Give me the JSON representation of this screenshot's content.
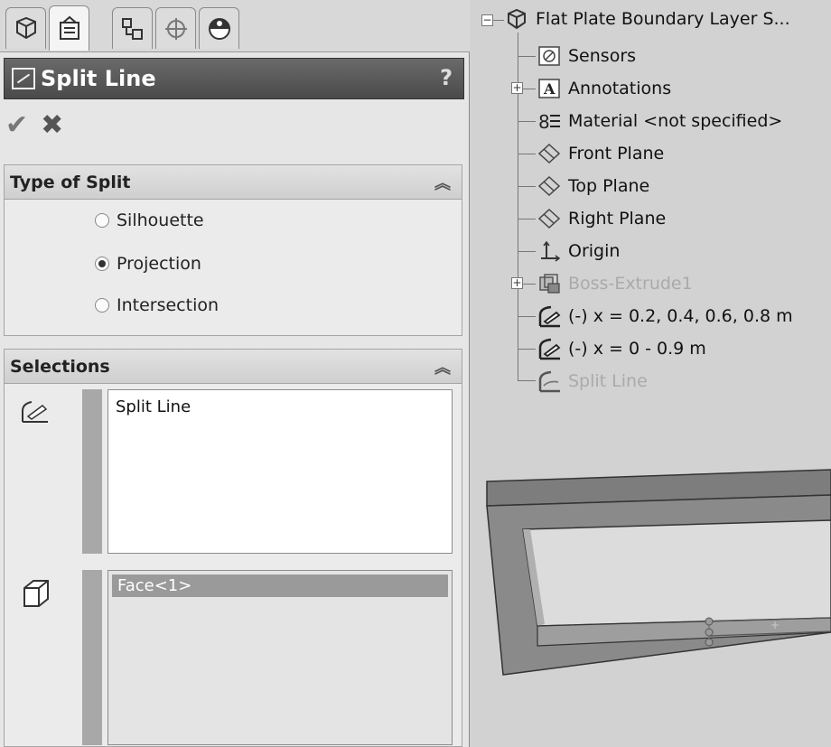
{
  "property_manager": {
    "tabs": [
      {
        "icon": "feature-manager-icon"
      },
      {
        "icon": "property-manager-icon"
      },
      {
        "icon": "configuration-manager-icon"
      },
      {
        "icon": "dim-xpert-icon"
      },
      {
        "icon": "display-manager-icon"
      }
    ],
    "title": "Split Line",
    "help": "?",
    "type_of_split": {
      "header": "Type of Split",
      "options": [
        "Silhouette",
        "Projection",
        "Intersection"
      ],
      "selected": "Projection"
    },
    "selections": {
      "header": "Selections",
      "sketch_list": [
        "Split Line"
      ],
      "face_list": [
        "Face<1>"
      ]
    }
  },
  "feature_tree": {
    "root": "Flat Plate Boundary Layer S...",
    "items": [
      {
        "label": "Sensors",
        "icon": "sensors-icon",
        "dimmed": false
      },
      {
        "label": "Annotations",
        "icon": "annotations-icon",
        "dimmed": false
      },
      {
        "label": "Material <not specified>",
        "icon": "material-icon",
        "dimmed": false
      },
      {
        "label": "Front Plane",
        "icon": "plane-icon",
        "dimmed": false
      },
      {
        "label": "Top Plane",
        "icon": "plane-icon",
        "dimmed": false
      },
      {
        "label": "Right Plane",
        "icon": "plane-icon",
        "dimmed": false
      },
      {
        "label": "Origin",
        "icon": "origin-icon",
        "dimmed": false
      },
      {
        "label": "Boss-Extrude1",
        "icon": "extrude-icon",
        "dimmed": true
      },
      {
        "label": "(-) x = 0.2, 0.4, 0.6, 0.8 m",
        "icon": "sketch-icon",
        "dimmed": false
      },
      {
        "label": "(-) x = 0 - 0.9 m",
        "icon": "sketch-icon",
        "dimmed": false
      },
      {
        "label": "Split Line",
        "icon": "split-line-icon",
        "dimmed": true
      }
    ]
  }
}
